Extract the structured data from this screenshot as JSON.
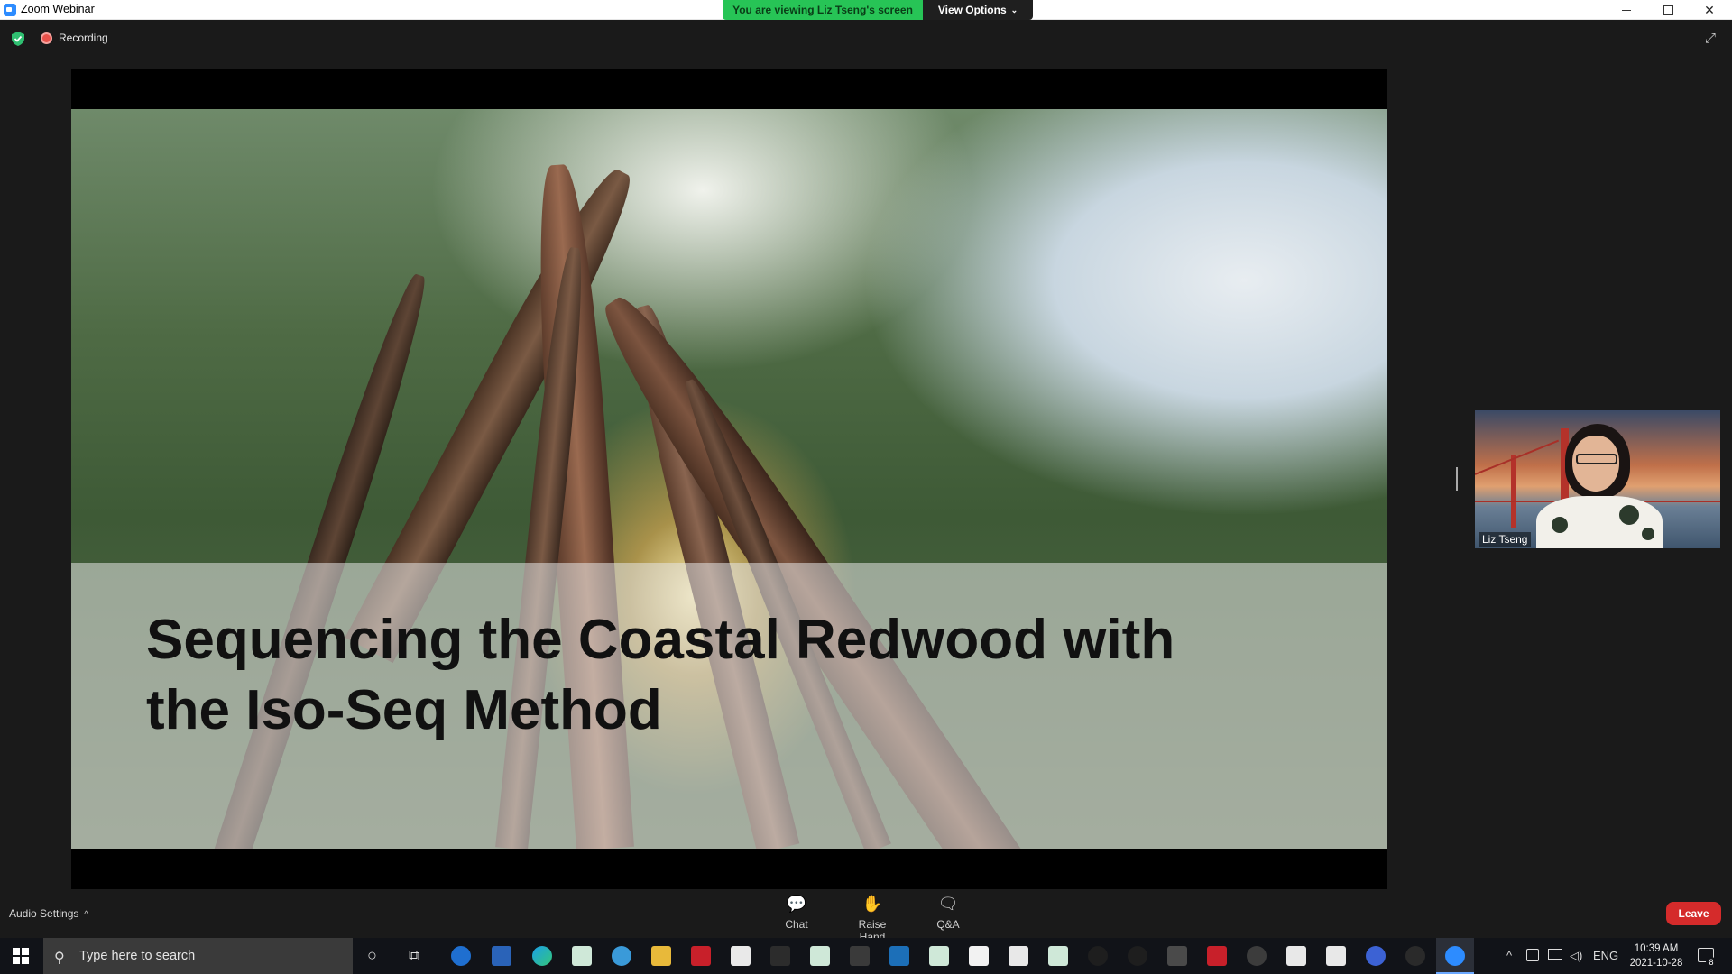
{
  "window": {
    "title": "Zoom Webinar",
    "close_glyph": "✕"
  },
  "banner": {
    "viewing_text": "You are viewing Liz Tseng's screen",
    "view_options_label": "View Options",
    "view_options_chevron": "⌄"
  },
  "status": {
    "recording_label": "Recording",
    "shield_color": "#2fbf71",
    "fullscreen_glyph": "⤢"
  },
  "slide": {
    "title_line1": "Sequencing the Coastal Redwood with",
    "title_line2": "the Iso-Seq Method"
  },
  "participant": {
    "name": "Liz Tseng"
  },
  "toolbar": {
    "audio_settings_label": "Audio Settings",
    "audio_caret": "^",
    "chat_label": "Chat",
    "chat_icon": "💬",
    "raise_hand_label": "Raise Hand",
    "raise_hand_icon": "✋",
    "qa_label": "Q&A",
    "qa_icon": "🗨",
    "leave_label": "Leave"
  },
  "taskbar": {
    "search_placeholder": "Type here to search",
    "search_icon": "⚲",
    "cortana_icon": "○",
    "taskview_icon": "⧉",
    "language": "ENG",
    "time": "10:39 AM",
    "date": "2021-10-28",
    "notification_count": "8",
    "tray_up": "^"
  }
}
